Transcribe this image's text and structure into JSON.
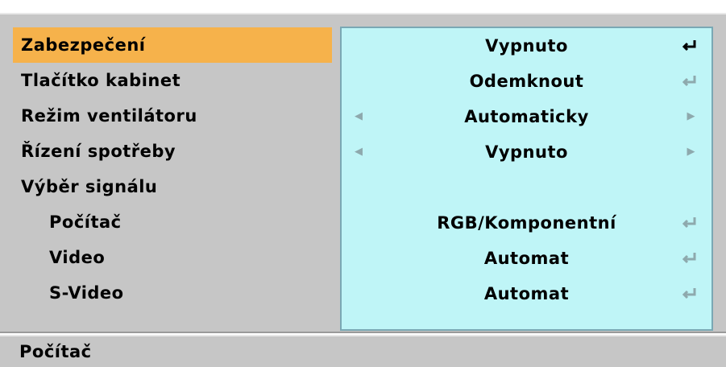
{
  "menu": {
    "rows": [
      {
        "label": "Zabezpečení",
        "value": "Vypnuto",
        "control": "enter",
        "selected": true
      },
      {
        "label": "Tlačítko kabinet",
        "value": "Odemknout",
        "control": "enter"
      },
      {
        "label": "Režim ventilátoru",
        "value": "Automaticky",
        "control": "arrows"
      },
      {
        "label": "Řízení spotřeby",
        "value": "Vypnuto",
        "control": "arrows"
      },
      {
        "label": "Výběr signálu",
        "value": "",
        "control": "none"
      },
      {
        "label": "Počítač",
        "value": "RGB/Komponentní",
        "control": "enter",
        "indent": true
      },
      {
        "label": "Video",
        "value": "Automat",
        "control": "enter",
        "indent": true
      },
      {
        "label": "S-Video",
        "value": "Automat",
        "control": "enter",
        "indent": true
      }
    ]
  },
  "status_bar": {
    "text": "Počítač"
  },
  "icons": {
    "enter": "enter-return-icon",
    "left": "arrow-left-icon",
    "right": "arrow-right-icon"
  },
  "colors": {
    "selected_row": "#f6b24b",
    "value_panel": "#bff5f7",
    "menu_background": "#c6c6c6"
  }
}
